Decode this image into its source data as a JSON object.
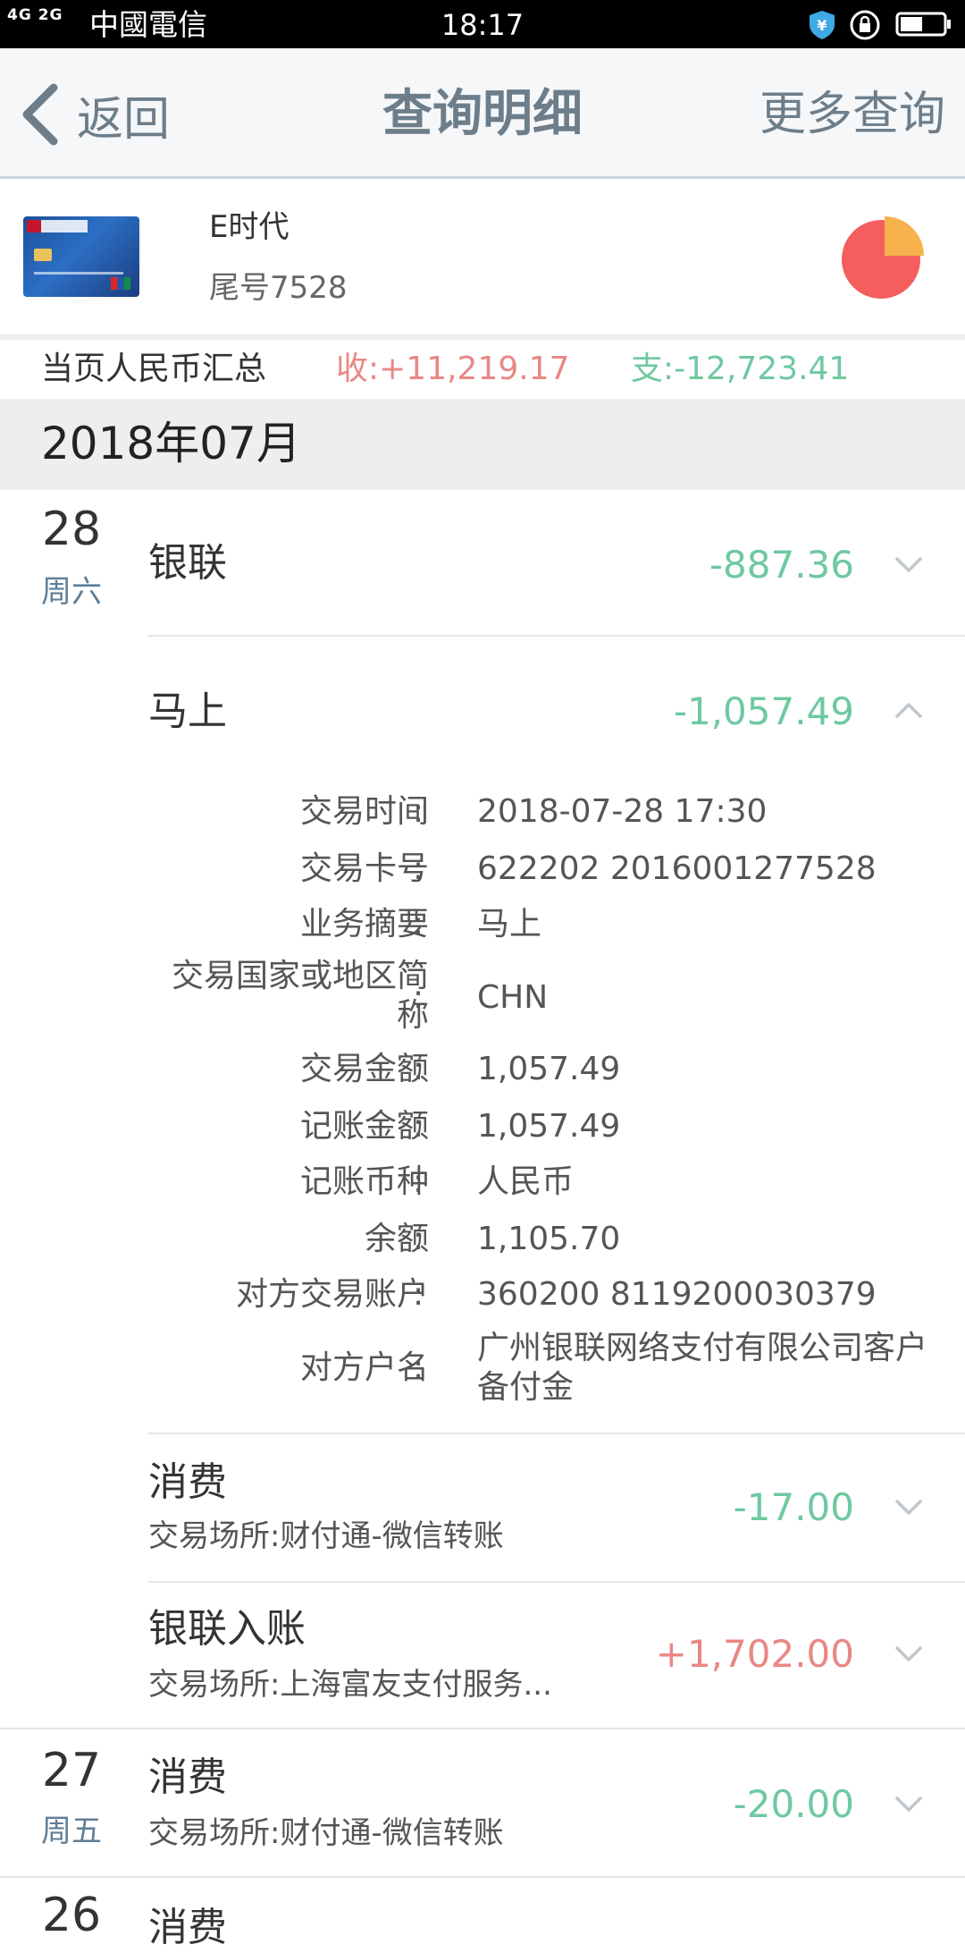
{
  "status_bar": {
    "network": "4G 2G",
    "carrier": "中國電信",
    "time": "18:17"
  },
  "nav": {
    "back_label": "返回",
    "title": "查询明细",
    "more_label": "更多查询"
  },
  "card": {
    "name": "E时代",
    "tail": "尾号7528"
  },
  "summary": {
    "label": "当页人民币汇总",
    "income": "收:+11,219.17",
    "expense": "支:-12,723.41"
  },
  "month": {
    "label": "2018年07月"
  },
  "days": [
    {
      "day": "28",
      "weekday": "周六",
      "transactions": [
        {
          "title": "银联",
          "amount": "-887.36"
        },
        {
          "title": "马上",
          "amount": "-1,057.49",
          "details": [
            {
              "label": "交易时间",
              "value": "2018-07-28 17:30"
            },
            {
              "label": "交易卡号",
              "value": "622202 2016001277528"
            },
            {
              "label": "业务摘要",
              "value": "马上"
            },
            {
              "label": "交易国家或地区简称",
              "value": "CHN"
            },
            {
              "label": "交易金额",
              "value": "1,057.49"
            },
            {
              "label": "记账金额",
              "value": "1,057.49"
            },
            {
              "label": "记账币种",
              "value": "人民币"
            },
            {
              "label": "余额",
              "value": "1,105.70"
            },
            {
              "label": "对方交易账户",
              "value": "360200 8119200030379"
            },
            {
              "label": "对方户名",
              "value": "广州银联网络支付有限公司客户备付金"
            }
          ]
        },
        {
          "title": "消费",
          "subtitle": "交易场所:财付通-微信转账",
          "amount": "-17.00"
        },
        {
          "title": "银联入账",
          "subtitle": "交易场所:上海富友支付服务...",
          "amount": "+1,702.00"
        }
      ]
    },
    {
      "day": "27",
      "weekday": "周五",
      "transactions": [
        {
          "title": "消费",
          "subtitle": "交易场所:财付通-微信转账",
          "amount": "-20.00"
        }
      ]
    },
    {
      "day": "26",
      "transactions": [
        {
          "title": "消费"
        }
      ]
    }
  ],
  "detail_colon": ":",
  "colors": {
    "expense": "#6ec9a0",
    "income": "#e88886",
    "nav_text": "#6d7e8a",
    "weekday": "#5f7e97",
    "pie_main": "#f45f5e",
    "pie_slice": "#f6b24d"
  }
}
